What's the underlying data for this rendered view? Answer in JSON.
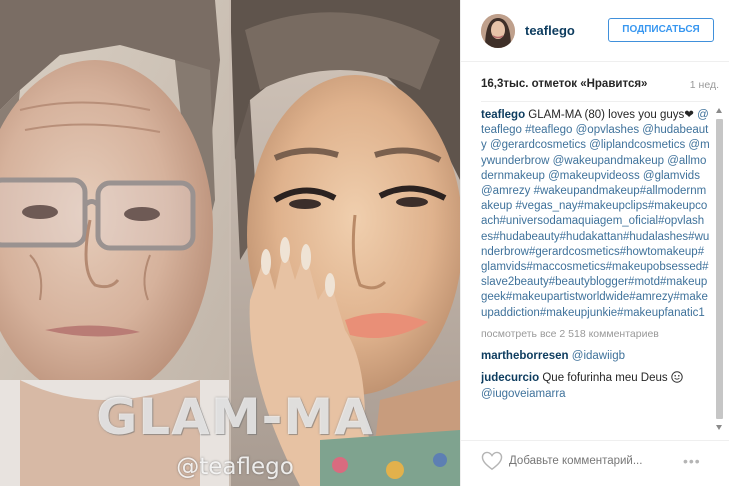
{
  "photo": {
    "watermark_title": "GLAM-MA",
    "watermark_handle": "@teaflego"
  },
  "header": {
    "username": "teaflego",
    "follow_label": "ПОДПИСАТЬСЯ"
  },
  "stats": {
    "likes": "16,3тыс. отметок «Нравится»",
    "time": "1 нед."
  },
  "caption": {
    "username": "teaflego",
    "text": "GLAM-MA (80) loves you guys",
    "heart": "❤",
    "tags": "@teaflego #teaflego @opvlashes @hudabeauty @gerardcosmetics @liplandcosmetics @mywunderbrow @wakeupandmakeup @allmodernmakeup @makeupvideoss @glamvids @amrezy #wakeupandmakeup#allmodernmakeup #vegas_nay#makeupclips#makeupcoach#universodamaquiagem_oficial#opvlashes#hudabeauty#hudakattan#hudalashes#wunderbrow#gerardcosmetics#howtomakeup#glamvids#maccosmetics#makeupobsessed#slave2beauty#beautyblogger#motd#makeupgeek#makeupartistworldwide#amrezy#makeupaddiction#makeupjunkie#makeupfanatic1"
  },
  "view_all_comments": "посмотреть все 2 518 комментариев",
  "comments": [
    {
      "username": "martheborresen",
      "text": "@idawiigb",
      "emoji": ""
    },
    {
      "username": "judecurcio",
      "text": "Que fofurinha meu Deus",
      "emoji": "slightly-smiling-face-icon"
    },
    {
      "username": "",
      "text": "@iugoveiamarra",
      "emoji": ""
    }
  ],
  "footer": {
    "comment_placeholder": "Добавьте комментарий...",
    "more_label": "•••"
  },
  "colors": {
    "link": "#3f729b",
    "username": "#0d3c5f",
    "follow_blue": "#3897f0",
    "muted": "#999999"
  }
}
